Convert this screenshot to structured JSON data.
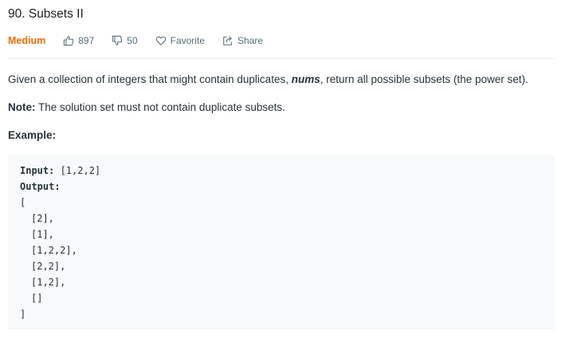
{
  "problem": {
    "title": "90. Subsets II",
    "difficulty": "Medium",
    "likes": "897",
    "dislikes": "50",
    "favorite_label": "Favorite",
    "share_label": "Share"
  },
  "description": {
    "text_before": "Given a collection of integers that might contain duplicates, ",
    "keyword": "nums",
    "text_after": ", return all possible subsets (the power set).",
    "note_label": "Note:",
    "note_text": " The solution set must not contain duplicate subsets.",
    "example_label": "Example:"
  },
  "example": {
    "input_label": "Input:",
    "input_value": " [1,2,2]",
    "output_label": "Output:",
    "open_bracket": "[",
    "items": [
      "[2],",
      "[1],",
      "[1,2,2],",
      "[2,2],",
      "[1,2],",
      "[]"
    ],
    "close_bracket": "]"
  },
  "icons": {
    "like": "thumbs-up-icon",
    "dislike": "thumbs-down-icon",
    "favorite": "heart-icon",
    "share": "share-icon"
  },
  "colors": {
    "difficulty_medium": "#ef6c00",
    "meta_text": "#546e7a",
    "code_background": "#f7f9fa"
  }
}
